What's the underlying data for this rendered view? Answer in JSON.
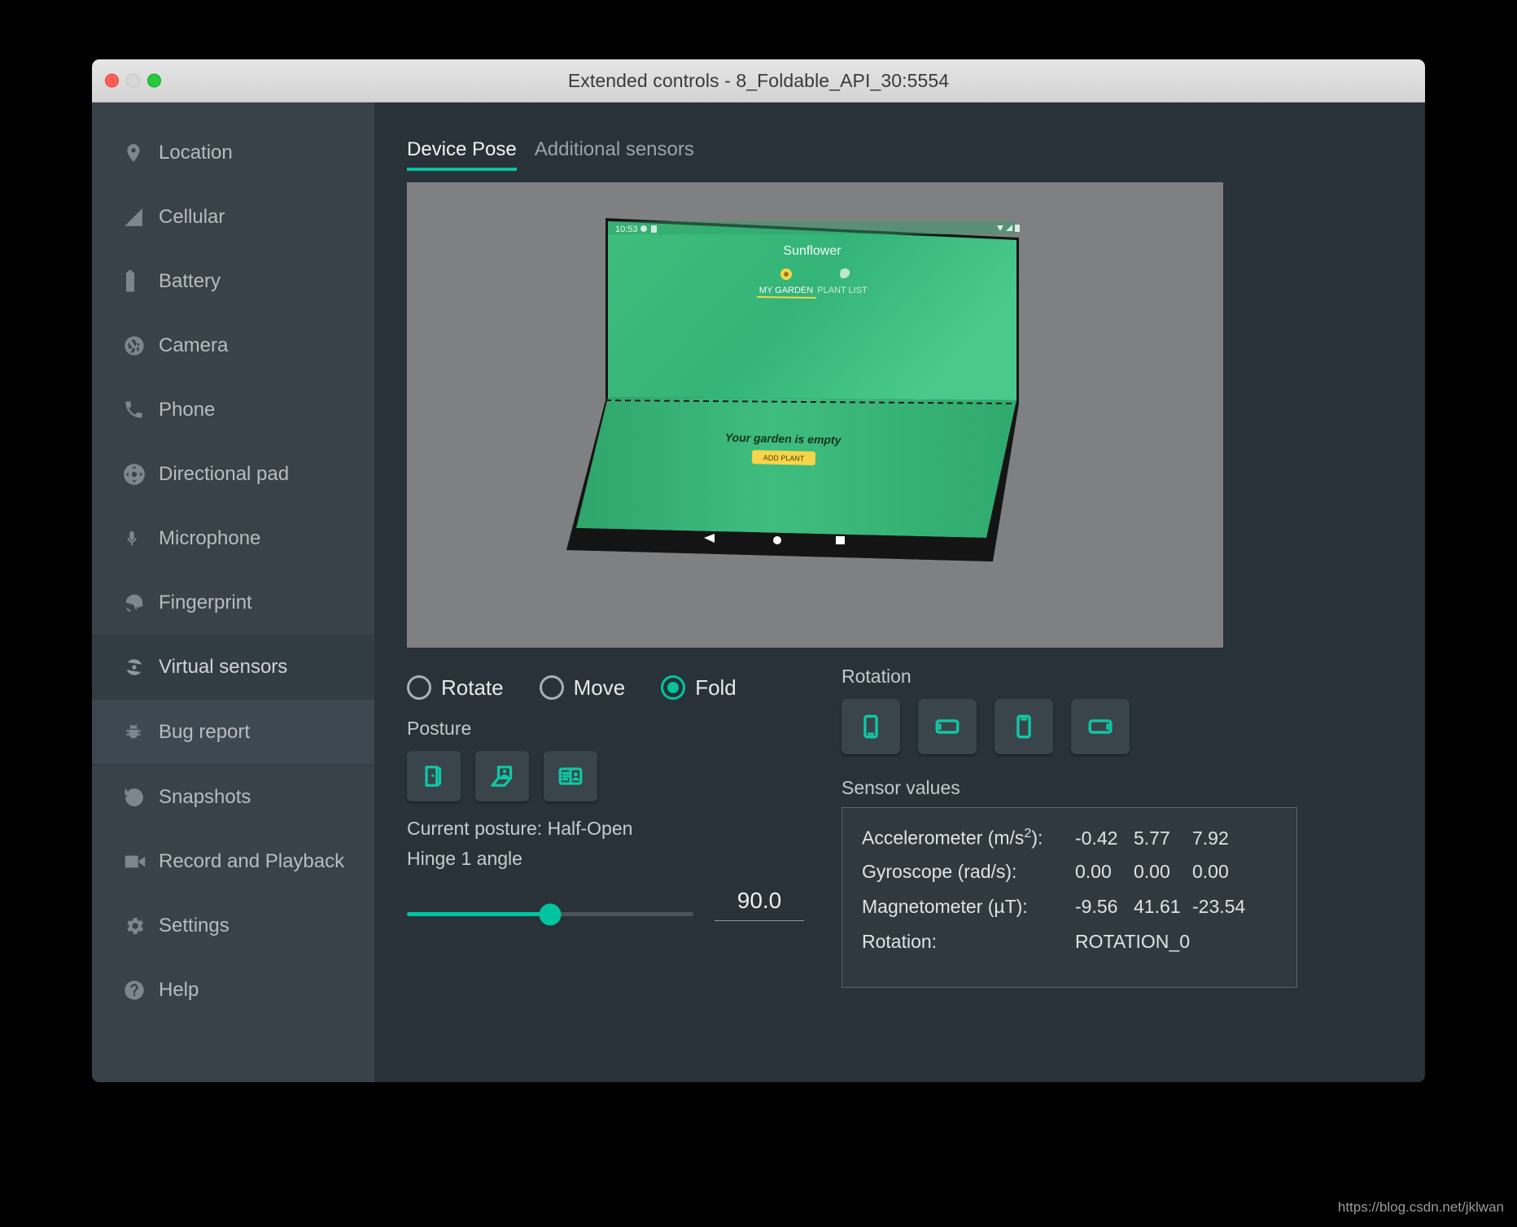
{
  "window": {
    "title": "Extended controls - 8_Foldable_API_30:5554",
    "traffic": {
      "close": "close-button",
      "minimize": "minimize-button",
      "zoom": "zoom-button"
    }
  },
  "sidebar": {
    "items": [
      {
        "label": "Location",
        "icon": "location-pin-icon",
        "state": "normal"
      },
      {
        "label": "Cellular",
        "icon": "cellular-signal-icon",
        "state": "normal"
      },
      {
        "label": "Battery",
        "icon": "battery-icon",
        "state": "normal"
      },
      {
        "label": "Camera",
        "icon": "camera-aperture-icon",
        "state": "normal"
      },
      {
        "label": "Phone",
        "icon": "phone-handset-icon",
        "state": "normal"
      },
      {
        "label": "Directional pad",
        "icon": "dpad-icon",
        "state": "normal"
      },
      {
        "label": "Microphone",
        "icon": "microphone-icon",
        "state": "normal"
      },
      {
        "label": "Fingerprint",
        "icon": "fingerprint-icon",
        "state": "normal"
      },
      {
        "label": "Virtual sensors",
        "icon": "virtual-sensors-icon",
        "state": "selected"
      },
      {
        "label": "Bug report",
        "icon": "bug-icon",
        "state": "hover"
      },
      {
        "label": "Snapshots",
        "icon": "snapshot-history-icon",
        "state": "normal"
      },
      {
        "label": "Record and Playback",
        "icon": "video-camera-icon",
        "state": "normal"
      },
      {
        "label": "Settings",
        "icon": "gear-icon",
        "state": "normal"
      },
      {
        "label": "Help",
        "icon": "help-circle-icon",
        "state": "normal"
      }
    ]
  },
  "tabs": [
    {
      "label": "Device Pose",
      "active": true
    },
    {
      "label": "Additional sensors",
      "active": false
    }
  ],
  "viewport": {
    "device_screen": {
      "status_time": "10:53",
      "app_title": "Sunflower",
      "tab_my_garden": "MY GARDEN",
      "tab_plant_list": "PLANT LIST",
      "empty_text": "Your garden is empty",
      "add_button": "ADD PLANT"
    }
  },
  "pose_modes": [
    {
      "label": "Rotate",
      "checked": false
    },
    {
      "label": "Move",
      "checked": false
    },
    {
      "label": "Fold",
      "checked": true
    }
  ],
  "posture": {
    "label": "Posture",
    "buttons": [
      {
        "icon": "posture-closed-icon"
      },
      {
        "icon": "posture-half-open-icon"
      },
      {
        "icon": "posture-open-icon"
      }
    ],
    "current_label": "Current posture:",
    "current_value": "Half-Open"
  },
  "hinge": {
    "label": "Hinge 1 angle",
    "value": "90.0",
    "min": 0,
    "max": 180,
    "percent": 50
  },
  "rotation": {
    "label": "Rotation",
    "buttons": [
      {
        "icon": "rotation-portrait-icon"
      },
      {
        "icon": "rotation-landscape-icon"
      },
      {
        "icon": "rotation-portrait-reverse-icon"
      },
      {
        "icon": "rotation-landscape-reverse-icon"
      }
    ]
  },
  "sensor_values": {
    "label": "Sensor values",
    "rows": [
      {
        "name": "Accelerometer (m/s",
        "sup": "2",
        "name_tail": "):",
        "values": [
          "-0.42",
          "5.77",
          "7.92"
        ]
      },
      {
        "name": "Gyroscope (rad/s):",
        "sup": "",
        "name_tail": "",
        "values": [
          "0.00",
          "0.00",
          "0.00"
        ]
      },
      {
        "name": "Magnetometer (µT):",
        "sup": "",
        "name_tail": "",
        "values": [
          "-9.56",
          "41.61",
          "-23.54"
        ]
      },
      {
        "name": "Rotation:",
        "sup": "",
        "name_tail": "",
        "values": [
          "ROTATION_0"
        ]
      }
    ]
  },
  "colors": {
    "accent": "#00c4a0",
    "sidebar_bg": "#394249",
    "main_bg": "#283238",
    "viewport_bg": "#7f8082"
  },
  "watermark": "https://blog.csdn.net/jklwan"
}
